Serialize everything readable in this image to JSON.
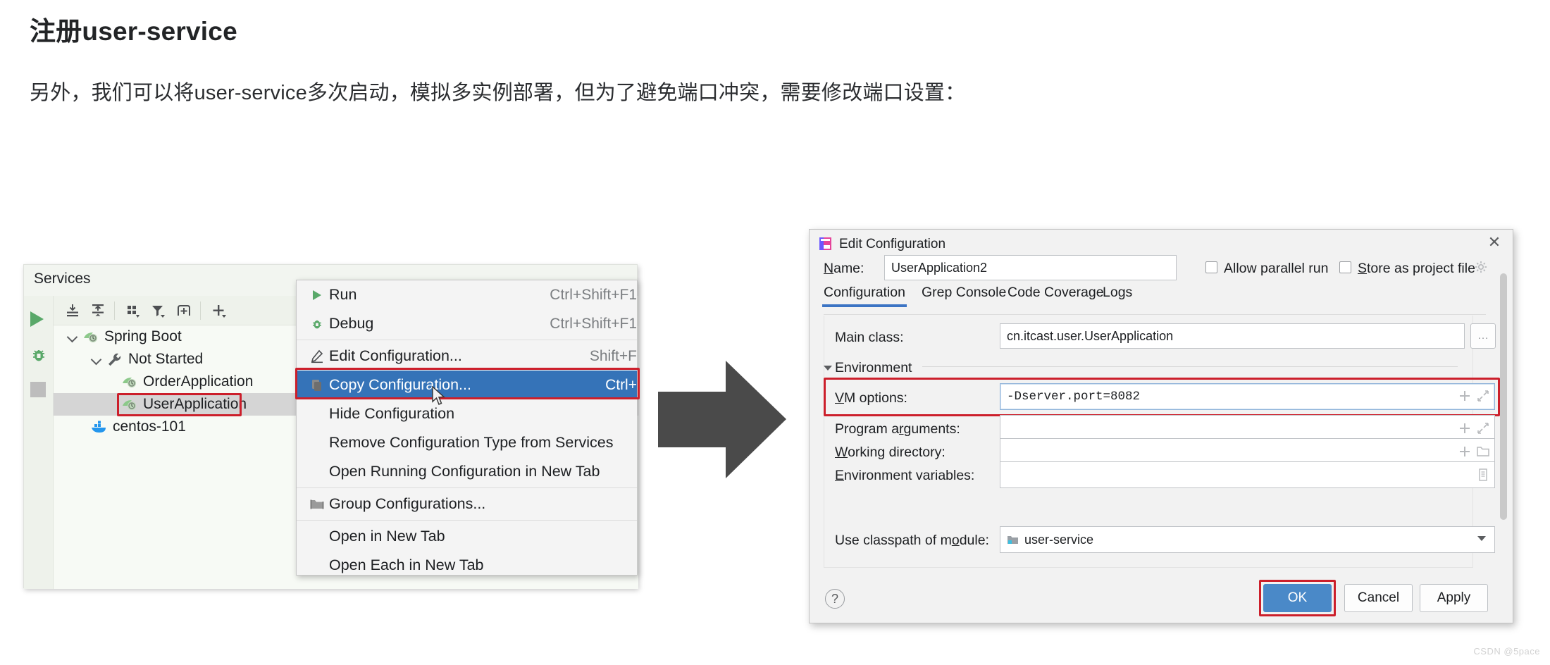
{
  "article": {
    "title": "注册user-service",
    "paragraph": "另外，我们可以将user-service多次启动，模拟多实例部署，但为了避免端口冲突，需要修改端口设置："
  },
  "services_panel": {
    "title": "Services",
    "rail": [
      {
        "name": "run-icon",
        "label": "Run"
      },
      {
        "name": "debug-icon",
        "label": "Debug"
      },
      {
        "name": "stop-icon",
        "label": "Stop"
      }
    ],
    "toolbar": [
      {
        "name": "expand-all-icon",
        "label": "Expand All"
      },
      {
        "name": "collapse-all-icon",
        "label": "Collapse All"
      },
      {
        "name": "group-by-icon",
        "label": "Group By"
      },
      {
        "name": "filter-icon",
        "label": "Filter"
      },
      {
        "name": "add-tab-icon",
        "label": "Add Tab"
      },
      {
        "name": "add-icon",
        "label": "Add"
      }
    ],
    "tree": [
      {
        "label": "Spring Boot",
        "depth": 0,
        "expanded": true,
        "icon": "spring-boot-icon",
        "selected": false
      },
      {
        "label": "Not Started",
        "depth": 1,
        "expanded": true,
        "icon": "wrench-icon",
        "selected": false
      },
      {
        "label": "OrderApplication",
        "depth": 2,
        "expanded": null,
        "icon": "spring-boot-icon",
        "selected": false
      },
      {
        "label": "UserApplication",
        "depth": 2,
        "expanded": null,
        "icon": "spring-boot-icon",
        "selected": true
      },
      {
        "label": "centos-101",
        "depth": 0,
        "expanded": null,
        "icon": "docker-icon",
        "selected": false
      }
    ]
  },
  "context_menu": {
    "items": [
      {
        "label": "Run",
        "shortcut": "Ctrl+Shift+F1",
        "icon": "run-icon",
        "highlight": false
      },
      {
        "label": "Debug",
        "shortcut": "Ctrl+Shift+F1",
        "icon": "debug-icon",
        "highlight": false
      },
      {
        "label": "Edit Configuration...",
        "shortcut": "Shift+F",
        "icon": "pencil-icon",
        "highlight": false
      },
      {
        "label": "Copy Configuration...",
        "shortcut": "Ctrl+",
        "icon": "copy-icon",
        "highlight": true
      },
      {
        "label": "Hide Configuration",
        "shortcut": "",
        "icon": "",
        "highlight": false
      },
      {
        "label": "Remove Configuration Type from Services",
        "shortcut": "",
        "icon": "",
        "highlight": false
      },
      {
        "label": "Open Running Configuration in New Tab",
        "shortcut": "",
        "icon": "",
        "highlight": false
      },
      {
        "label": "Group Configurations...",
        "shortcut": "",
        "icon": "folder-icon",
        "highlight": false
      },
      {
        "label": "Open in New Tab",
        "shortcut": "",
        "icon": "",
        "highlight": false
      },
      {
        "label": "Open Each in New Tab",
        "shortcut": "",
        "icon": "",
        "highlight": false
      }
    ]
  },
  "dialog": {
    "title": "Edit Configuration",
    "close_label": "✕",
    "name_label": "Name:",
    "name_value": "UserApplication2",
    "name_placeholder": "",
    "checkboxes": [
      {
        "label": "Allow parallel run",
        "checked": false
      },
      {
        "label": "Store as project file",
        "checked": false
      }
    ],
    "gear_icon": "gear-icon",
    "tabs": [
      {
        "label": "Configuration",
        "active": true
      },
      {
        "label": "Grep Console",
        "active": false
      },
      {
        "label": "Code Coverage",
        "active": false
      },
      {
        "label": "Logs",
        "active": false
      }
    ],
    "env_section_label": "Environment",
    "fields": [
      {
        "label": "Main class:",
        "value": "cn.itcast.user.UserApplication",
        "placeholder": "",
        "mono": false,
        "focused": false,
        "adorn": "ellipsis-button"
      },
      {
        "label": "VM options:",
        "value": "-Dserver.port=8082",
        "placeholder": "",
        "mono": true,
        "focused": true,
        "adorn": "plus-expand"
      },
      {
        "label": "Program arguments:",
        "value": "",
        "placeholder": "",
        "mono": false,
        "focused": false,
        "adorn": "plus-expand"
      },
      {
        "label": "Working directory:",
        "value": "",
        "placeholder": "",
        "mono": false,
        "focused": false,
        "adorn": "plus-folder"
      },
      {
        "label": "Environment variables:",
        "value": "",
        "placeholder": "",
        "mono": false,
        "focused": false,
        "adorn": "list-button"
      }
    ],
    "module_label": "Use classpath of module:",
    "module_value": "user-service",
    "module_icon": "module-icon",
    "help_label": "?",
    "buttons": [
      {
        "label": "OK",
        "primary": true,
        "highlighted": true
      },
      {
        "label": "Cancel",
        "primary": false,
        "highlighted": false
      },
      {
        "label": "Apply",
        "primary": false,
        "highlighted": false
      }
    ]
  },
  "colors": {
    "accent_blue": "#3573b8",
    "primary_button": "#4a89c8",
    "highlight_red": "#cc1f2b",
    "spring_green": "#59a869"
  },
  "watermark": "CSDN @5pace"
}
